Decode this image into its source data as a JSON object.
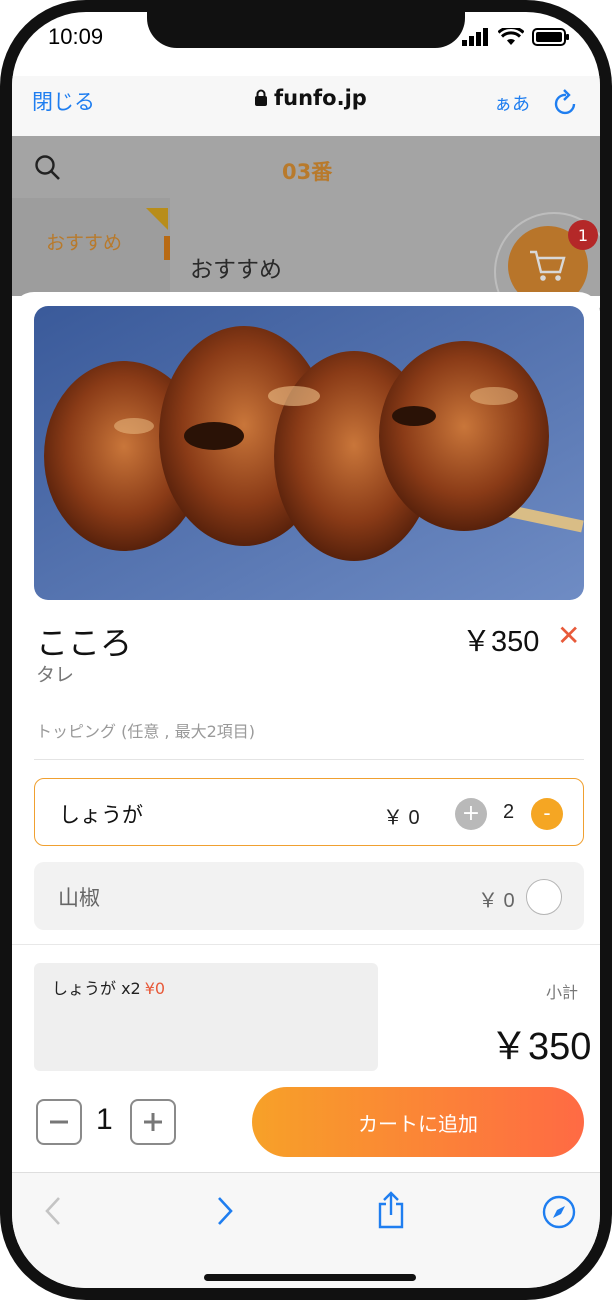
{
  "status": {
    "time": "10:09"
  },
  "browser": {
    "close_label": "閉じる",
    "url": "funfo.jp",
    "text_size_label": "ぁあ"
  },
  "page": {
    "table_label": "03番",
    "category_selected": "おすすめ",
    "section_title": "おすすめ",
    "cart_count": "1"
  },
  "item": {
    "name": "こころ",
    "subtitle": "タレ",
    "price": "￥350",
    "photo_alt": "yakitori",
    "topping_header": "トッピング (任意 , 最大2項目)",
    "options": [
      {
        "name": "しょうが",
        "price": "￥ 0",
        "qty": "2",
        "plus": "+",
        "minus": "-"
      },
      {
        "name": "山椒",
        "price": "￥ 0"
      }
    ]
  },
  "summary": {
    "line_name": "しょうが x2",
    "line_price": "¥0",
    "subtotal_label": "小計",
    "subtotal_value": "￥350",
    "quantity": "1",
    "add_to_cart_label": "カートに追加"
  },
  "colors": {
    "accent_orange": "#f5a623",
    "gradient_start": "#f7a128",
    "gradient_end": "#ff6a44",
    "link_blue": "#1f7ef0",
    "close_red": "#e85a3a"
  }
}
